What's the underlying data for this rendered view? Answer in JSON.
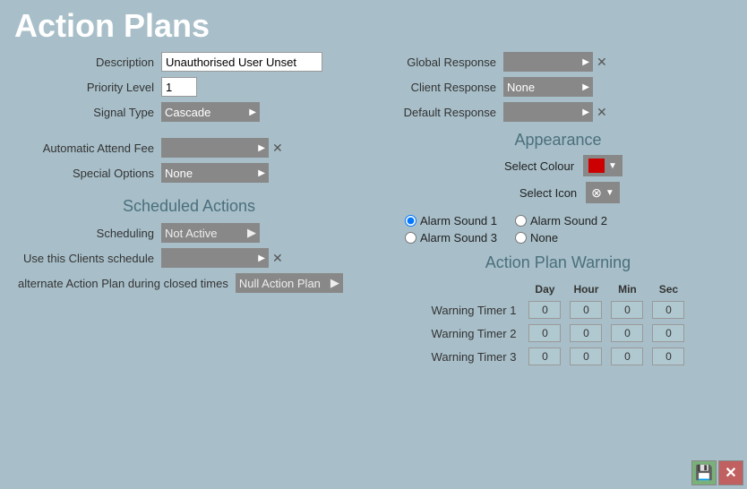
{
  "page": {
    "title": "Action Plans"
  },
  "form": {
    "description_label": "Description",
    "description_value": "Unauthorised User Unset",
    "priority_level_label": "Priority Level",
    "priority_level_value": "1",
    "signal_type_label": "Signal Type",
    "signal_type_value": "Cascade",
    "global_response_label": "Global Response",
    "client_response_label": "Client Response",
    "client_response_value": "None",
    "default_response_label": "Default Response",
    "automatic_attend_fee_label": "Automatic Attend Fee",
    "special_options_label": "Special Options",
    "special_options_value": "None"
  },
  "appearance": {
    "title": "Appearance",
    "select_colour_label": "Select Colour",
    "select_icon_label": "Select Icon"
  },
  "scheduled": {
    "title": "Scheduled Actions",
    "scheduling_label": "Scheduling",
    "scheduling_value": "Not Active",
    "use_client_label": "Use this Clients schedule",
    "alternate_label": "alternate Action Plan during closed times",
    "alternate_value": "Null Action Plan"
  },
  "alarm_sound": {
    "alarm1": "Alarm Sound 1",
    "alarm2": "Alarm Sound 2",
    "alarm3": "Alarm Sound 3",
    "none": "None"
  },
  "warning": {
    "title": "Action Plan Warning",
    "day_label": "Day",
    "hour_label": "Hour",
    "min_label": "Min",
    "sec_label": "Sec",
    "timer1_label": "Warning Timer 1",
    "timer2_label": "Warning Timer 2",
    "timer3_label": "Warning Timer 3",
    "timer1_day": "0",
    "timer1_hour": "0",
    "timer1_min": "0",
    "timer1_sec": "0",
    "timer2_day": "0",
    "timer2_hour": "0",
    "timer2_min": "0",
    "timer2_sec": "0",
    "timer3_day": "0",
    "timer3_hour": "0",
    "timer3_min": "0",
    "timer3_sec": "0"
  },
  "buttons": {
    "save": "💾",
    "cancel": "✕",
    "arrow": "▶",
    "dropdown_arrow": "▼",
    "x": "✕",
    "icon_symbol": "⊗"
  }
}
